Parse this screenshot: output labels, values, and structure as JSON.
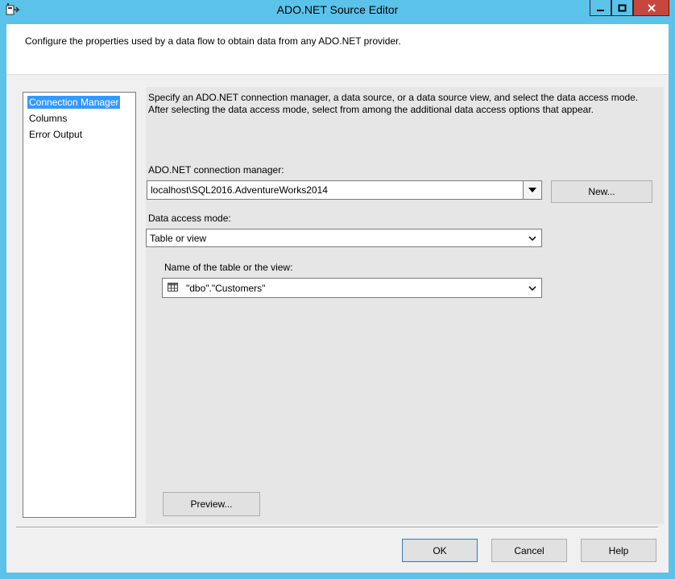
{
  "window": {
    "title": "ADO.NET Source Editor"
  },
  "header": {
    "text": "Configure the properties used by a data flow to obtain data from any ADO.NET provider."
  },
  "nav": {
    "items": [
      {
        "label": "Connection Manager",
        "selected": true
      },
      {
        "label": "Columns",
        "selected": false
      },
      {
        "label": "Error Output",
        "selected": false
      }
    ]
  },
  "main": {
    "description": "Specify an ADO.NET connection manager, a data source, or a data source view, and select the data access mode. After selecting the data access mode, select from among the additional data access options that appear.",
    "connection_label": "ADO.NET connection manager:",
    "connection_value": "localhost\\SQL2016.AdventureWorks2014",
    "new_button": "New...",
    "access_mode_label": "Data access mode:",
    "access_mode_value": "Table or view",
    "table_label": "Name of the table or the view:",
    "table_value": "\"dbo\".\"Customers\"",
    "preview_button": "Preview..."
  },
  "footer": {
    "ok": "OK",
    "cancel": "Cancel",
    "help": "Help"
  },
  "colors": {
    "title_bar": "#5bc3ea",
    "close_button": "#c7463d",
    "selection": "#3399ff"
  },
  "icons": [
    "application-icon",
    "minimize-icon",
    "maximize-icon",
    "close-icon",
    "chevron-down-icon",
    "table-icon"
  ]
}
